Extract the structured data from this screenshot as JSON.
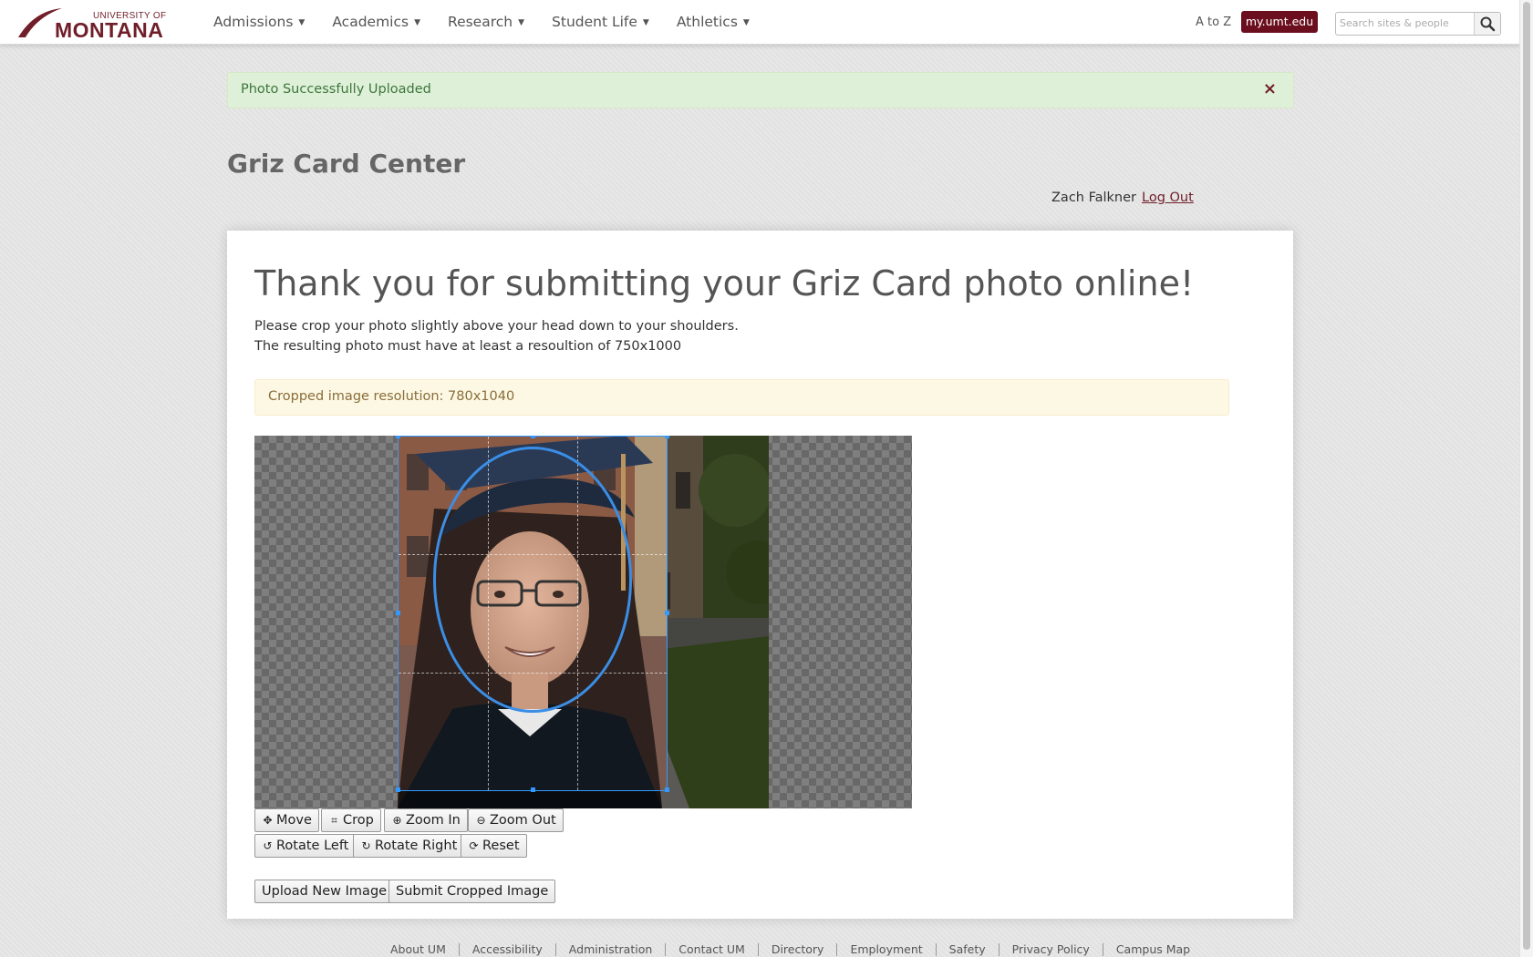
{
  "navbar": {
    "logo": {
      "line1": "UNIVERSITY OF",
      "line2": "MONTANA"
    },
    "items": [
      {
        "label": "Admissions"
      },
      {
        "label": "Academics"
      },
      {
        "label": "Research"
      },
      {
        "label": "Student Life"
      },
      {
        "label": "Athletics"
      }
    ],
    "atoz": "A to Z",
    "portal_button": "my.umt.edu",
    "search_placeholder": "Search sites & people",
    "search_icon": "search-icon"
  },
  "alert": {
    "message": "Photo Successfully Uploaded",
    "close": "×",
    "color": "#dff0d8"
  },
  "page": {
    "title": "Griz Card Center"
  },
  "user": {
    "name": "Zach Falkner",
    "logout": "Log Out"
  },
  "panel": {
    "heading": "Thank you for submitting your Griz Card photo online!",
    "instructions": [
      "Please crop your photo slightly above your head down to your shoulders.",
      "The resulting photo must have at least a resoultion of 750x1000"
    ],
    "resolution_note": "Cropped image resolution: 780x1040"
  },
  "tools": {
    "row1": [
      {
        "label": "Move",
        "icon": "move-icon"
      },
      {
        "label": "Crop",
        "icon": "crop-icon"
      },
      {
        "label": "Zoom In",
        "icon": "zoom-in-icon"
      },
      {
        "label": "Zoom Out",
        "icon": "zoom-out-icon"
      }
    ],
    "row2": [
      {
        "label": "Rotate Left",
        "icon": "rotate-left-icon"
      },
      {
        "label": "Rotate Right",
        "icon": "rotate-right-icon"
      },
      {
        "label": "Reset",
        "icon": "reset-icon"
      }
    ]
  },
  "actions": {
    "upload": "Upload New Image",
    "submit": "Submit Cropped Image"
  },
  "footer": [
    "About UM",
    "Accessibility",
    "Administration",
    "Contact UM",
    "Directory",
    "Employment",
    "Safety",
    "Privacy Policy",
    "Campus Map"
  ],
  "colors": {
    "brand": "#701e29",
    "portal_button": "#6b0f1e",
    "crop_guide": "#3399ff"
  }
}
